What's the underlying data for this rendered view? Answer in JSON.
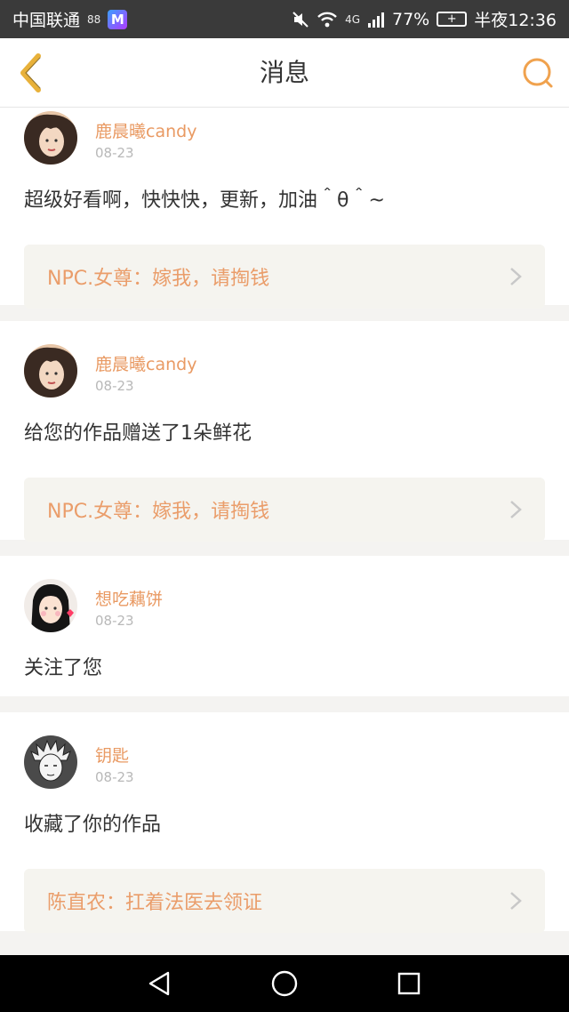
{
  "status_bar": {
    "carrier": "中国联通",
    "carrier_extra": "88",
    "app_badge": "M",
    "network": "4G",
    "battery": "77%",
    "time": "半夜12:36"
  },
  "header": {
    "title": "消息",
    "accent_color": "#f0a24e"
  },
  "notifications": [
    {
      "username": "鹿晨曦candy",
      "date": "08-23",
      "message": "超级好看啊，快快快，更新，加油＾θ＾~",
      "work": "NPC.女尊：嫁我，请掏钱",
      "avatar": "avatar-girl-1"
    },
    {
      "username": "鹿晨曦candy",
      "date": "08-23",
      "message": "给您的作品赠送了1朵鲜花",
      "work": "NPC.女尊：嫁我，请掏钱",
      "avatar": "avatar-girl-1"
    },
    {
      "username": "想吃藕饼",
      "date": "08-23",
      "message": "关注了您",
      "work": null,
      "avatar": "avatar-girl-2"
    },
    {
      "username": "钥匙",
      "date": "08-23",
      "message": "收藏了你的作品",
      "work": "陈直农：扛着法医去领证",
      "avatar": "avatar-sketch"
    }
  ],
  "icons": {
    "back": "chevron-left-icon",
    "search": "search-icon",
    "nav_back": "triangle-back-icon",
    "nav_home": "circle-home-icon",
    "nav_recent": "square-recent-icon"
  }
}
